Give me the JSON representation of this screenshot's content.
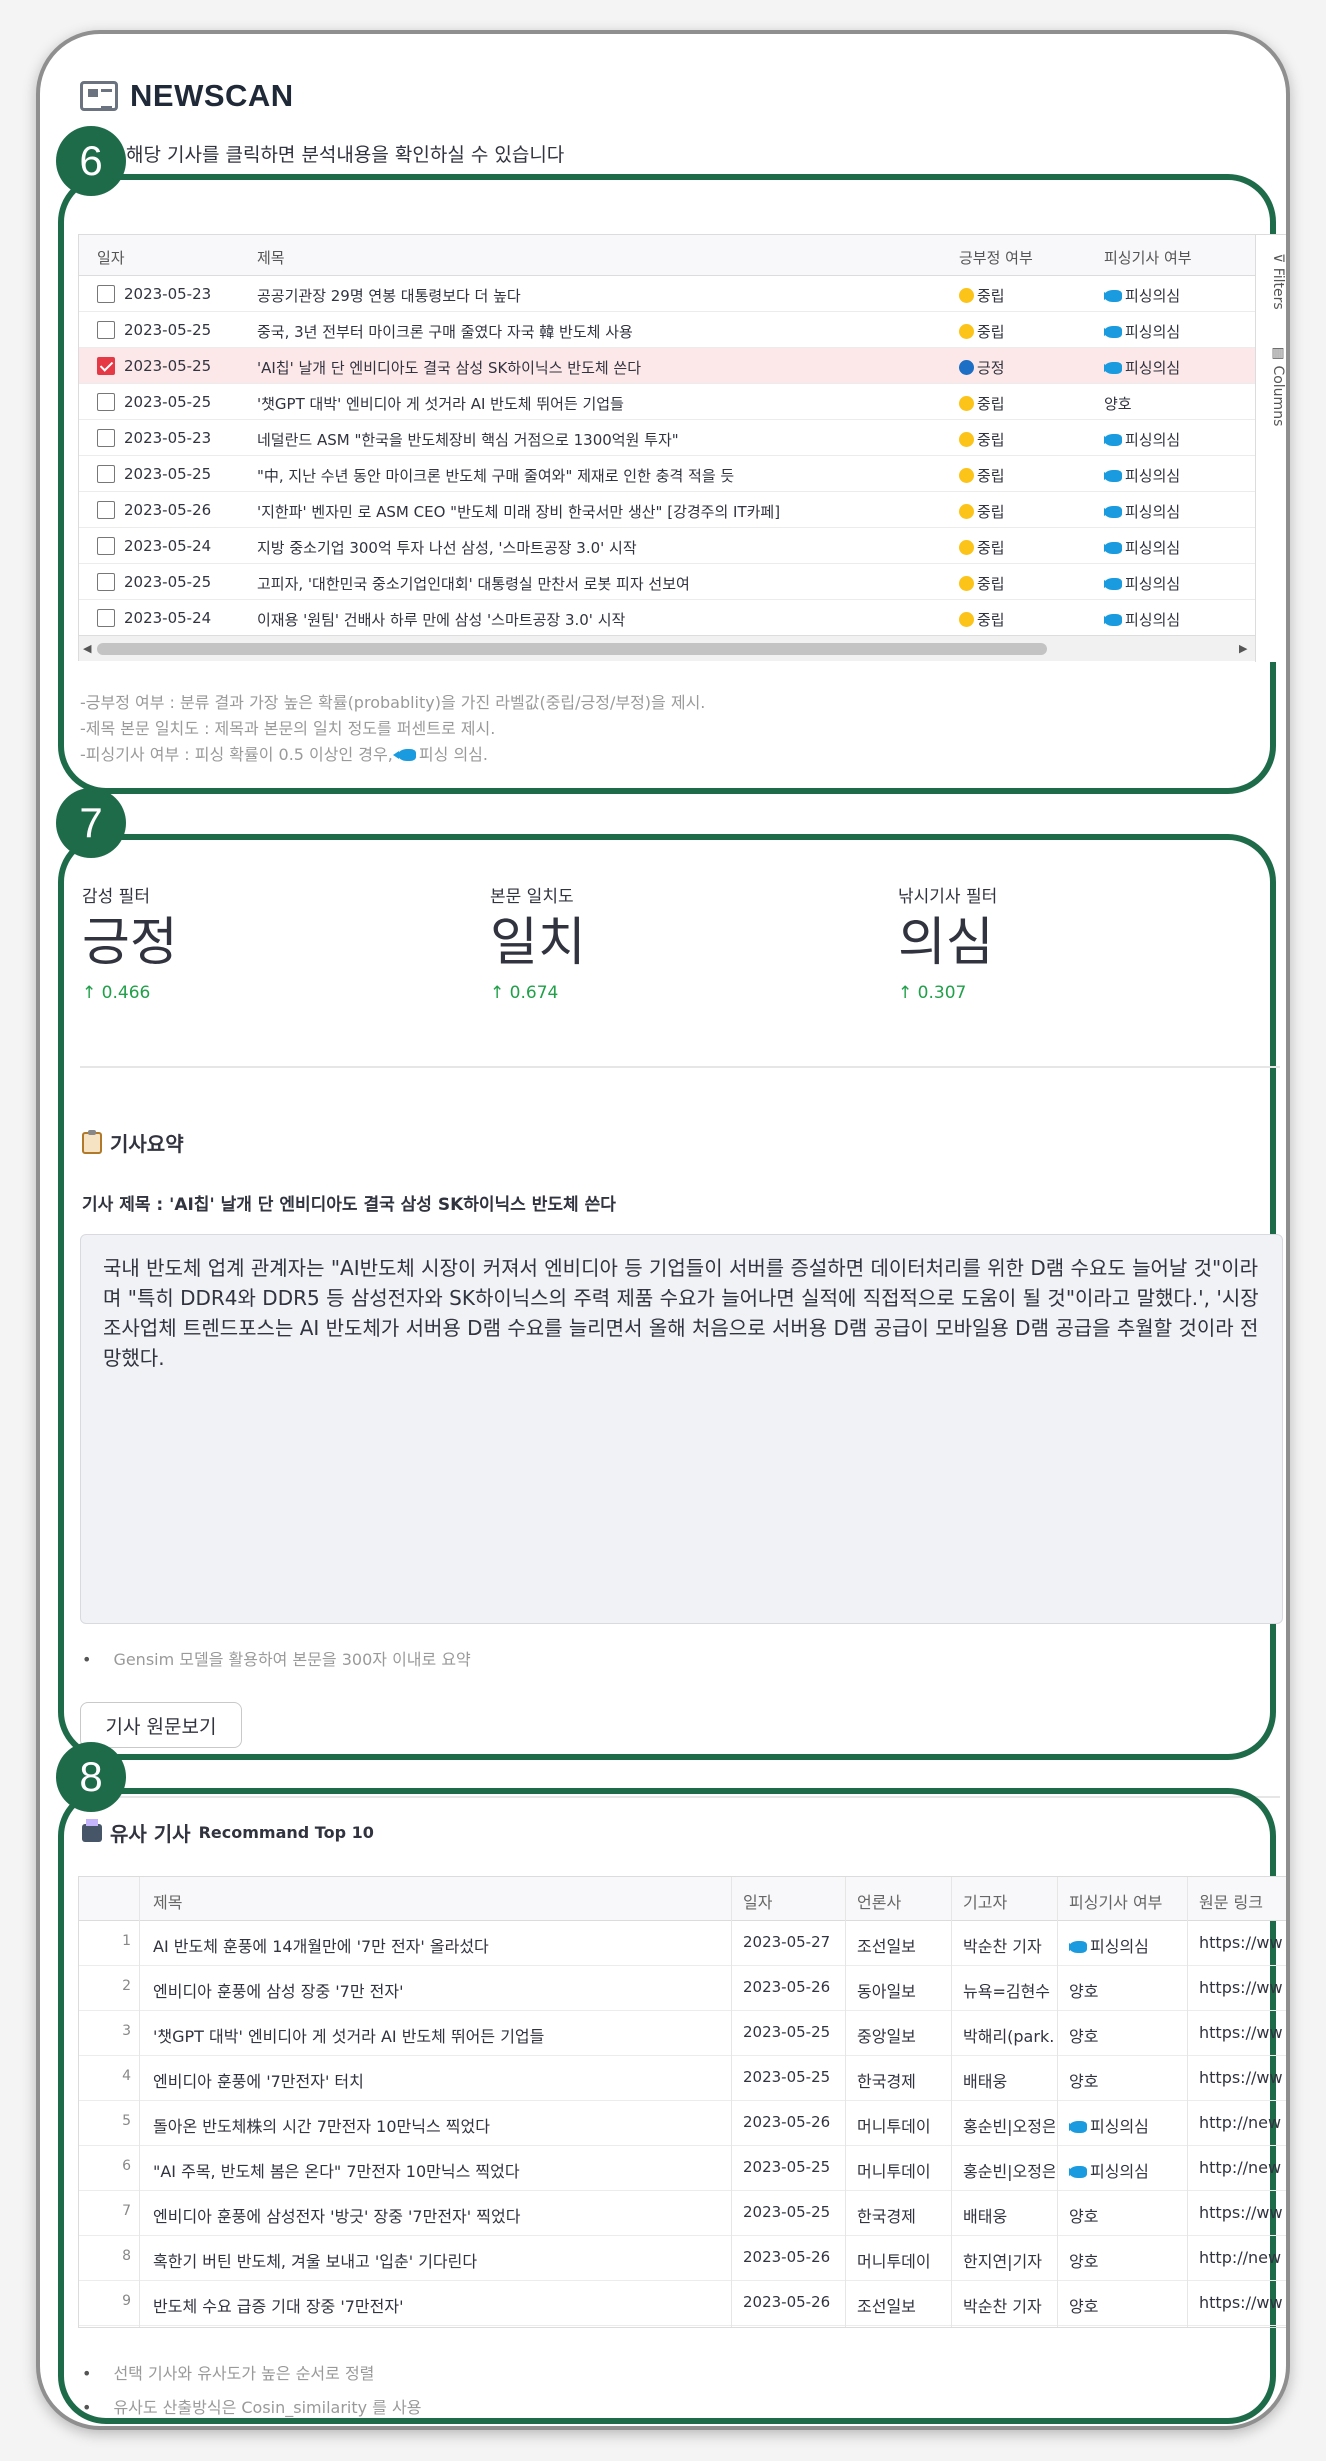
{
  "app": {
    "title": "NEWSCAN",
    "subtitle": "해당 기사를 클릭하면 분석내용을 확인하실 수 있습니다"
  },
  "badges": {
    "b6": "6",
    "b7": "7",
    "b8": "8"
  },
  "articles_table": {
    "headers": {
      "date": "일자",
      "title": "제목",
      "sentiment": "긍부정 여부",
      "phishing": "피싱기사 여부"
    },
    "sidebar": {
      "filters": "Filters",
      "columns": "Columns"
    },
    "rows": [
      {
        "checked": false,
        "date": "2023-05-23",
        "title": "공공기관장 29명 연봉 대통령보다 더 높다",
        "sentiment": "중립",
        "sentiment_color": "#fcc419",
        "phishing": "피싱의심",
        "phishing_fish": true
      },
      {
        "checked": false,
        "date": "2023-05-25",
        "title": "중국, 3년 전부터 마이크론 구매 줄였다 자국 韓 반도체 사용",
        "sentiment": "중립",
        "sentiment_color": "#fcc419",
        "phishing": "피싱의심",
        "phishing_fish": true
      },
      {
        "checked": true,
        "date": "2023-05-25",
        "title": "'AI칩' 날개 단 엔비디아도 결국 삼성 SK하이닉스 반도체 쓴다",
        "sentiment": "긍정",
        "sentiment_color": "#1c6fc4",
        "phishing": "피싱의심",
        "phishing_fish": true
      },
      {
        "checked": false,
        "date": "2023-05-25",
        "title": "'챗GPT 대박' 엔비디아 게 섯거라 AI 반도체 뛰어든 기업들",
        "sentiment": "중립",
        "sentiment_color": "#fcc419",
        "phishing": "양호",
        "phishing_fish": false
      },
      {
        "checked": false,
        "date": "2023-05-23",
        "title": "네덜란드 ASM \"한국을 반도체장비 핵심 거점으로 1300억원 투자\"",
        "sentiment": "중립",
        "sentiment_color": "#fcc419",
        "phishing": "피싱의심",
        "phishing_fish": true
      },
      {
        "checked": false,
        "date": "2023-05-25",
        "title": "\"中, 지난 수년 동안 마이크론 반도체 구매 줄여와\" 제재로 인한 충격 적을 듯",
        "sentiment": "중립",
        "sentiment_color": "#fcc419",
        "phishing": "피싱의심",
        "phishing_fish": true
      },
      {
        "checked": false,
        "date": "2023-05-26",
        "title": "'지한파' 벤자민 로 ASM CEO \"반도체 미래 장비 한국서만 생산\" [강경주의 IT카페]",
        "sentiment": "중립",
        "sentiment_color": "#fcc419",
        "phishing": "피싱의심",
        "phishing_fish": true
      },
      {
        "checked": false,
        "date": "2023-05-24",
        "title": "지방 중소기업 300억 투자 나선 삼성, '스마트공장 3.0' 시작",
        "sentiment": "중립",
        "sentiment_color": "#fcc419",
        "phishing": "피싱의심",
        "phishing_fish": true
      },
      {
        "checked": false,
        "date": "2023-05-25",
        "title": "고피자, '대한민국 중소기업인대회' 대통령실 만찬서 로봇 피자 선보여",
        "sentiment": "중립",
        "sentiment_color": "#fcc419",
        "phishing": "피싱의심",
        "phishing_fish": true
      },
      {
        "checked": false,
        "date": "2023-05-24",
        "title": "이재용 '원팀' 건배사 하루 만에 삼성 '스마트공장 3.0' 시작",
        "sentiment": "중립",
        "sentiment_color": "#fcc419",
        "phishing": "피싱의심",
        "phishing_fish": true
      }
    ],
    "notes": [
      "-긍부정 여부 : 분류 결과 가장 높은 확률(probablity)을 가진 라벨값(중립/긍정/부정)을 제시.",
      "-제목 본문 일치도 : 제목과 본문의 일치 정도를 퍼센트로 제시.",
      "-피싱기사 여부 : 피싱 확률이 0.5 이상인 경우,",
      "피싱 의심."
    ]
  },
  "metrics": [
    {
      "label": "감성 필터",
      "value": "긍정",
      "delta": "0.466"
    },
    {
      "label": "본문 일치도",
      "value": "일치",
      "delta": "0.674"
    },
    {
      "label": "낚시기사 필터",
      "value": "의심",
      "delta": "0.307"
    }
  ],
  "summary": {
    "heading": "기사요약",
    "article_title": "기사 제목 : 'AI칩' 날개 단 엔비디아도 결국 삼성 SK하이닉스 반도체 쓴다",
    "text": "국내 반도체 업계 관계자는 \"AI반도체 시장이 커져서 엔비디아 등 기업들이 서버를 증설하면 데이터처리를 위한 D램 수요도 늘어날 것\"이라며 \"특히 DDR4와 DDR5 등 삼성전자와 SK하이닉스의 주력 제품 수요가 늘어나면 실적에 직접적으로 도움이 될 것\"이라고 말했다.', '시장조사업체 트렌드포스는 AI 반도체가 서버용 D램 수요를 늘리면서 올해 처음으로 서버용 D램 공급이 모바일용 D램 공급을 추월할 것이라 전망했다.",
    "note": "Gensim 모델을 활용하여 본문을 300자 이내로 요약",
    "button": "기사 원문보기"
  },
  "similar": {
    "heading": "유사 기사",
    "heading_sub": "Recommand Top 10",
    "headers": {
      "title": "제목",
      "date": "일자",
      "press": "언론사",
      "reporter": "기고자",
      "phishing": "피싱기사 여부",
      "link": "원문 링크"
    },
    "rows": [
      {
        "no": "1",
        "title": "AI 반도체 훈풍에 14개월만에 '7만 전자' 올라섰다",
        "date": "2023-05-27",
        "press": "조선일보",
        "reporter": "박순찬 기자",
        "phishing": "피싱의심",
        "fish": true,
        "link": "https://ww"
      },
      {
        "no": "2",
        "title": "엔비디아 훈풍에 삼성 장중 '7만 전자'",
        "date": "2023-05-26",
        "press": "동아일보",
        "reporter": "뉴욕=김현수",
        "phishing": "양호",
        "fish": false,
        "link": "https://ww"
      },
      {
        "no": "3",
        "title": "'챗GPT 대박' 엔비디아 게 섯거라 AI 반도체 뛰어든 기업들",
        "date": "2023-05-25",
        "press": "중앙일보",
        "reporter": "박해리(park.h",
        "phishing": "양호",
        "fish": false,
        "link": "https://ww"
      },
      {
        "no": "4",
        "title": "엔비디아 훈풍에 '7만전자' 터치",
        "date": "2023-05-25",
        "press": "한국경제",
        "reporter": "배태웅",
        "phishing": "양호",
        "fish": false,
        "link": "https://ww"
      },
      {
        "no": "5",
        "title": "돌아온 반도체株의 시간 7만전자 10만닉스 찍었다",
        "date": "2023-05-26",
        "press": "머니투데이",
        "reporter": "홍순빈|오정은",
        "phishing": "피싱의심",
        "fish": true,
        "link": "http://new"
      },
      {
        "no": "6",
        "title": "\"AI 주목, 반도체 봄은 온다\" 7만전자 10만닉스 찍었다",
        "date": "2023-05-25",
        "press": "머니투데이",
        "reporter": "홍순빈|오정은",
        "phishing": "피싱의심",
        "fish": true,
        "link": "http://new"
      },
      {
        "no": "7",
        "title": "엔비디아 훈풍에 삼성전자 '방긋' 장중 '7만전자' 찍었다",
        "date": "2023-05-25",
        "press": "한국경제",
        "reporter": "배태웅",
        "phishing": "양호",
        "fish": false,
        "link": "https://ww"
      },
      {
        "no": "8",
        "title": "혹한기 버틴 반도체, 겨울 보내고 '입춘' 기다린다",
        "date": "2023-05-26",
        "press": "머니투데이",
        "reporter": "한지연|기자",
        "phishing": "양호",
        "fish": false,
        "link": "http://new"
      },
      {
        "no": "9",
        "title": "반도체 수요 급증 기대 장중 '7만전자'",
        "date": "2023-05-26",
        "press": "조선일보",
        "reporter": "박순찬 기자",
        "phishing": "양호",
        "fish": false,
        "link": "https://ww"
      }
    ],
    "notes": [
      "선택 기사와 유사도가 높은 순서로 정렬",
      "유사도 산출방식은 Cosin_similarity 를 사용"
    ]
  }
}
